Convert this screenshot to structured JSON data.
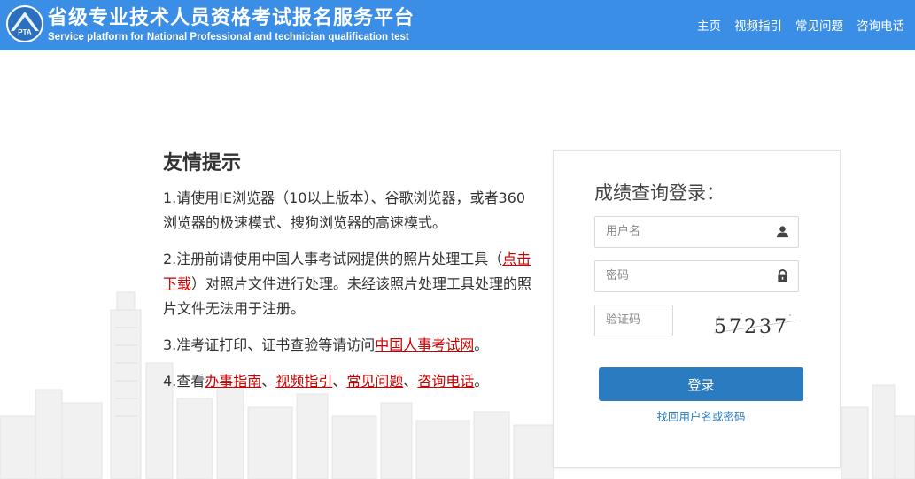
{
  "header": {
    "title_cn": "省级专业技术人员资格考试报名服务平台",
    "title_en": "Service platform for National Professional and technician qualification test",
    "logo_text": "PTA",
    "nav": [
      {
        "label": "主页"
      },
      {
        "label": "视频指引"
      },
      {
        "label": "常见问题"
      },
      {
        "label": "咨询电话"
      }
    ]
  },
  "notice": {
    "heading": "友情提示",
    "item1": "1.请使用IE浏览器（10以上版本）、谷歌浏览器，或者360浏览器的极速模式、搜狗浏览器的高速模式。",
    "item2_pre": "2.注册前请使用中国人事考试网提供的照片处理工具（",
    "item2_link": "点击下载",
    "item2_post": "）对照片文件进行处理。未经该照片处理工具处理的照片文件无法用于注册。",
    "item3_pre": "3.准考证打印、证书查验等请访问",
    "item3_link": "中国人事考试网",
    "item3_post": "。",
    "item4_pre": "4.查看",
    "item4_links": [
      "办事指南",
      "视频指引",
      "常见问题",
      "咨询电话"
    ],
    "item4_sep": "、",
    "item4_post": "。"
  },
  "login": {
    "title": "成绩查询登录：",
    "username_placeholder": "用户名",
    "password_placeholder": "密码",
    "captcha_placeholder": "验证码",
    "captcha_text": "57237",
    "login_label": "登录",
    "forgot_label": "找回用户名或密码"
  },
  "colors": {
    "header_bg": "#3a8ee6",
    "link_red": "#cc0000",
    "button_blue": "#2b7bc1"
  }
}
